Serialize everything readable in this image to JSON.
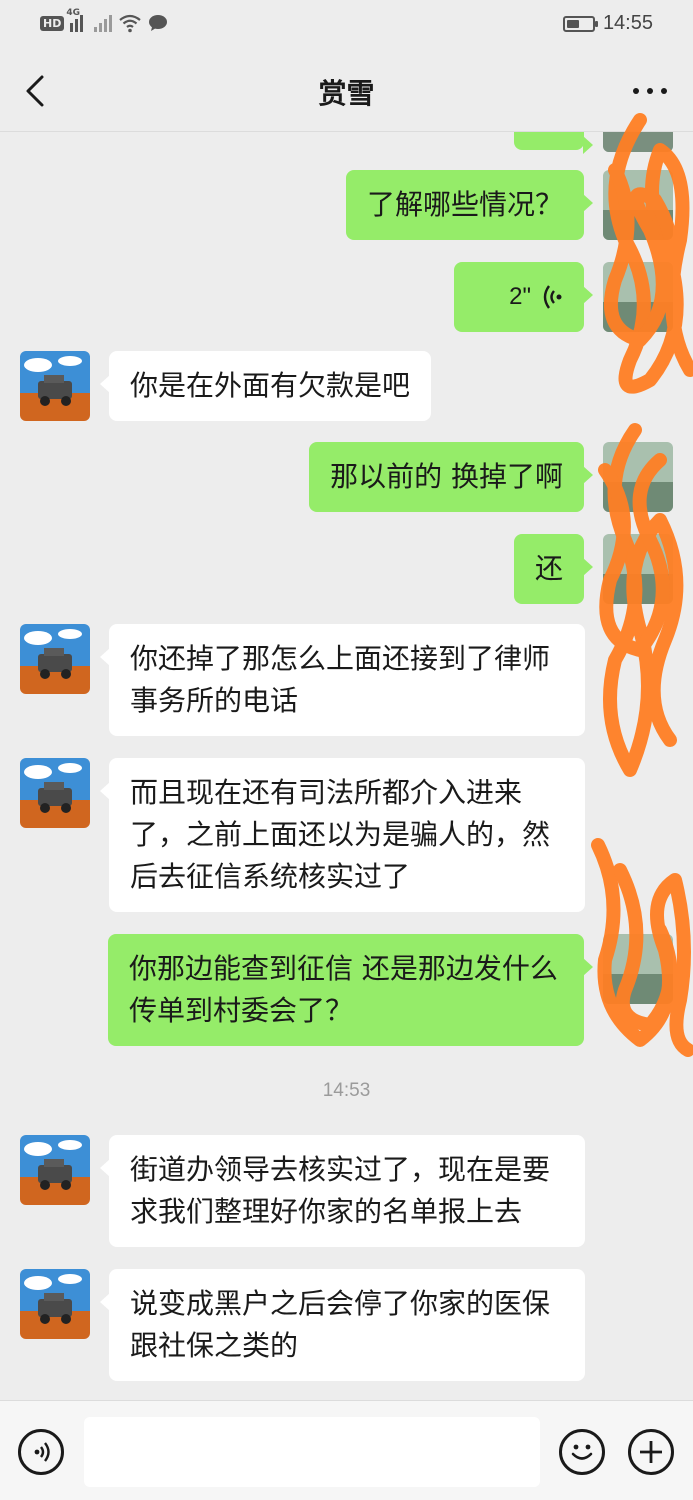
{
  "status_bar": {
    "hd": "HD",
    "network": "4G",
    "time": "14:55",
    "battery_level_percent": 50
  },
  "header": {
    "title": "赏雪",
    "back_icon": "chevron-left-icon",
    "more_icon": "more-dots-icon"
  },
  "messages": [
    {
      "side": "out",
      "text": "了解哪些情况？"
    },
    {
      "side": "out",
      "type": "voice",
      "duration": "2\""
    },
    {
      "side": "in",
      "text": "你是在外面有欠款是吧"
    },
    {
      "side": "out",
      "text": "那以前的 换掉了啊"
    },
    {
      "side": "out",
      "text": "还"
    },
    {
      "side": "in",
      "text": "你还掉了那怎么上面还接到了律师事务所的电话"
    },
    {
      "side": "in",
      "text": "而且现在还有司法所都介入进来了，之前上面还以为是骗人的，然后去征信系统核实过了"
    },
    {
      "side": "out",
      "text": "你那边能查到征信 还是那边发什么传单到村委会了？"
    },
    {
      "side": "in",
      "text": "街道办领导去核实过了，现在是要求我们整理好你家的名单报上去"
    },
    {
      "side": "in",
      "text": "说变成黑户之后会停了你家的医保跟社保之类的"
    }
  ],
  "timestamp": "14:53",
  "input_bar": {
    "voice_icon": "voice-input-icon",
    "emoji_icon": "emoji-icon",
    "plus_icon": "plus-icon",
    "placeholder": ""
  },
  "colors": {
    "background": "#ededed",
    "outgoing_bubble": "#95ec69",
    "incoming_bubble": "#ffffff",
    "scribble": "#ff7f24"
  }
}
